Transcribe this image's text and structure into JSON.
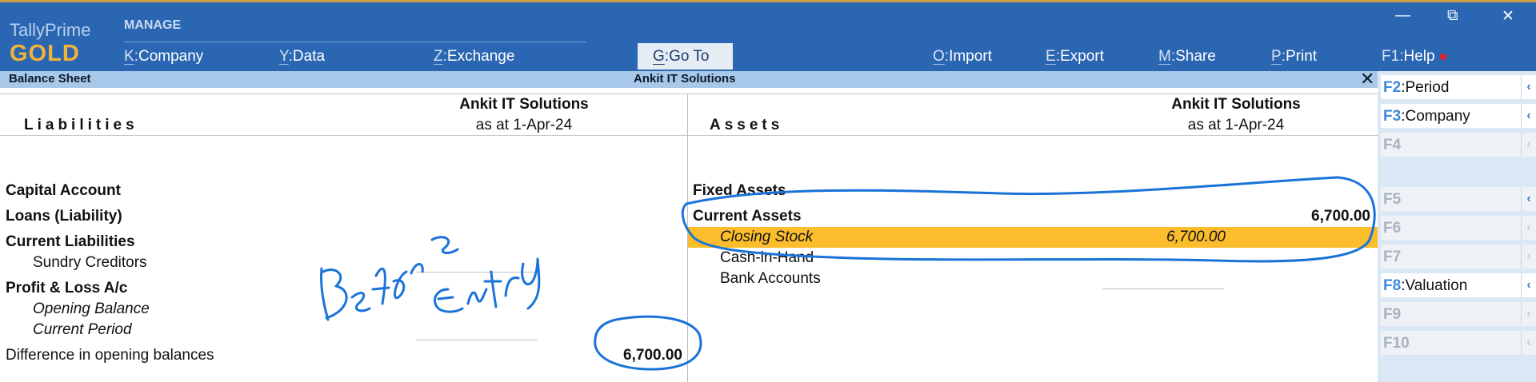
{
  "brand": {
    "line1": "TallyPrime",
    "line2": "GOLD"
  },
  "menu": {
    "section_label": "MANAGE",
    "items": [
      {
        "key": "K",
        "label": "Company"
      },
      {
        "key": "Y",
        "label": "Data"
      },
      {
        "key": "Z",
        "label": "Exchange"
      },
      {
        "key": "G",
        "label": "Go To"
      },
      {
        "key": "O",
        "label": "Import"
      },
      {
        "key": "E",
        "label": "Export"
      },
      {
        "key": "M",
        "label": "Share"
      },
      {
        "key": "P",
        "label": "Print"
      },
      {
        "key": "F1",
        "label": "Help"
      }
    ]
  },
  "window_controls": {
    "minimize": "—",
    "restore": "⧉",
    "close": "✕"
  },
  "report": {
    "title": "Balance Sheet",
    "company_center": "Ankit IT Solutions",
    "close_glyph": "✕",
    "liabilities": {
      "heading": "Liabilities",
      "company": "Ankit IT Solutions",
      "date": "as at 1-Apr-24",
      "rows": [
        {
          "label": "Capital Account"
        },
        {
          "label": "Loans (Liability)"
        },
        {
          "label": "Current Liabilities"
        },
        {
          "label": "Sundry Creditors"
        },
        {
          "label": "Profit & Loss A/c"
        },
        {
          "label": "Opening Balance"
        },
        {
          "label": "Current Period"
        },
        {
          "label": "Difference in opening balances",
          "amount": "6,700.00"
        }
      ]
    },
    "assets": {
      "heading": "Assets",
      "company": "Ankit IT Solutions",
      "date": "as at 1-Apr-24",
      "rows": [
        {
          "label": "Fixed Assets"
        },
        {
          "label": "Current Assets",
          "amount": "6,700.00"
        },
        {
          "label": "Closing Stock",
          "amount": "6,700.00"
        },
        {
          "label": "Cash-in-Hand"
        },
        {
          "label": "Bank Accounts"
        }
      ]
    }
  },
  "right_panel": [
    {
      "key": "F2",
      "label": "Period",
      "enabled": true
    },
    {
      "key": "F3",
      "label": "Company",
      "enabled": true
    },
    {
      "key": "F4",
      "label": "",
      "enabled": false
    },
    {
      "key": "F5",
      "label": "",
      "enabled": false
    },
    {
      "key": "F6",
      "label": "",
      "enabled": false
    },
    {
      "key": "F7",
      "label": "",
      "enabled": false
    },
    {
      "key": "F8",
      "label": "Valuation",
      "enabled": true
    },
    {
      "key": "F9",
      "label": "",
      "enabled": false
    },
    {
      "key": "F10",
      "label": "",
      "enabled": false
    }
  ],
  "colors": {
    "topbar": "#2b66b2",
    "brand_gold": "#f2b33a",
    "highlight": "#fbbd2b",
    "annotation_ink": "#1a73d9"
  }
}
